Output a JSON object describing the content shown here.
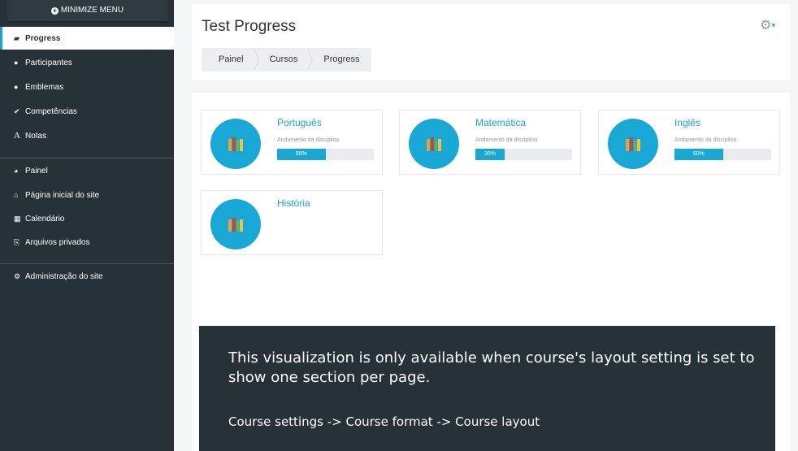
{
  "sidebar": {
    "minimize_label": "MINIMIZE MENU",
    "items": [
      {
        "label": "Progress",
        "icon": "graduation-cap-icon",
        "glyph": "🎓"
      },
      {
        "label": "Participantes",
        "icon": "users-icon",
        "glyph": "👥"
      },
      {
        "label": "Emblemas",
        "icon": "badge-icon",
        "glyph": "●"
      },
      {
        "label": "Competências",
        "icon": "check-circle-icon",
        "glyph": "✔"
      },
      {
        "label": "Notas",
        "icon": "grades-icon",
        "glyph": "A"
      },
      {
        "label": "Painel",
        "icon": "dashboard-icon",
        "glyph": "◕"
      },
      {
        "label": "Página inicial do site",
        "icon": "home-icon",
        "glyph": "⌂"
      },
      {
        "label": "Calendário",
        "icon": "calendar-icon",
        "glyph": "▦"
      },
      {
        "label": "Arquivos privados",
        "icon": "files-icon",
        "glyph": "⎘"
      },
      {
        "label": "Administração do site",
        "icon": "cogs-icon",
        "glyph": "⚙"
      }
    ]
  },
  "header": {
    "title": "Test Progress",
    "breadcrumb": [
      "Painel",
      "Cursos",
      "Progress"
    ],
    "gear_icon": "gear-icon"
  },
  "courses": [
    {
      "name": "Português",
      "progress_label": "Andamento da disciplina",
      "progress_percent": 50,
      "progress_text": "50%"
    },
    {
      "name": "Matemática",
      "progress_label": "Andamento da disciplina",
      "progress_percent": 30,
      "progress_text": "30%"
    },
    {
      "name": "Inglês",
      "progress_label": "Andamento da disciplina",
      "progress_percent": 50,
      "progress_text": "50%"
    },
    {
      "name": "História"
    }
  ],
  "notice": {
    "message": "This visualization is only available when course's layout setting is set to show one section per page.",
    "path": "Course settings -> Course format -> Course layout"
  },
  "colors": {
    "sidebar_bg": "#263238",
    "accent": "#19a7d6",
    "link": "#1b9fd4"
  }
}
